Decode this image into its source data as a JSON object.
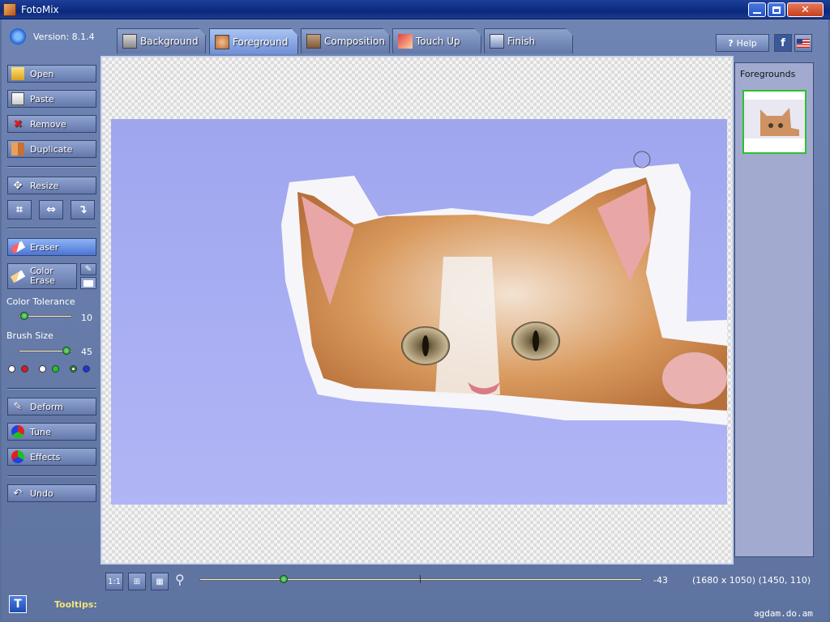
{
  "window": {
    "title": "FotoMix"
  },
  "app": {
    "version": "Version: 8.1.4"
  },
  "tabs": [
    {
      "label": "Background",
      "active": false,
      "icon": "background-tab-icon"
    },
    {
      "label": "Foreground",
      "active": true,
      "icon": "foreground-tab-icon"
    },
    {
      "label": "Composition",
      "active": false,
      "icon": "composition-tab-icon"
    },
    {
      "label": "Touch Up",
      "active": false,
      "icon": "touchup-tab-icon"
    },
    {
      "label": "Finish",
      "active": false,
      "icon": "finish-tab-icon"
    }
  ],
  "topright": {
    "help": "Help",
    "facebook": "f",
    "language": "en-us-flag-icon"
  },
  "sidebar": {
    "open": "Open",
    "paste": "Paste",
    "remove": "Remove",
    "duplicate": "Duplicate",
    "resize": "Resize",
    "eraser": "Eraser",
    "color_erase_line1": "Color",
    "color_erase_line2": "Erase",
    "color_tolerance_label": "Color Tolerance",
    "color_tolerance_value": "10",
    "color_tolerance_fraction": 0.1,
    "brush_size_label": "Brush Size",
    "brush_size_value": "45",
    "brush_size_fraction": 0.9,
    "deform": "Deform",
    "tune": "Tune",
    "effects": "Effects",
    "undo": "Undo"
  },
  "foregrounds": {
    "title": "Foregrounds"
  },
  "bottom": {
    "zoom_value": "-43",
    "zoom_fraction": 0.19,
    "coords": "(1680 x 1050) (1450, 110)",
    "tooltips_label": "Tooltips:",
    "tooltips_btn": "T"
  },
  "watermark": "agdam.do.am",
  "colors": {
    "accent": "#2453c6",
    "panel": "#6f84b3",
    "selected_border": "#2fbf2f"
  }
}
